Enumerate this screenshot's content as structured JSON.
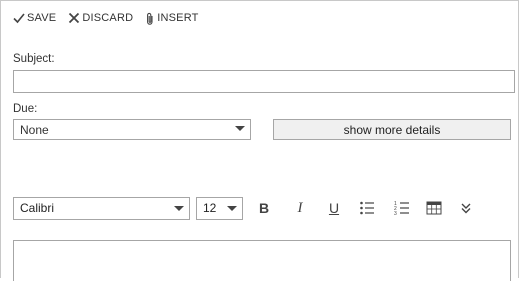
{
  "toolbar": {
    "save_label": "SAVE",
    "discard_label": "DISCARD",
    "insert_label": "INSERT"
  },
  "form": {
    "subject_label": "Subject:",
    "subject_value": "",
    "due_label": "Due:",
    "due_value": "None",
    "details_button_label": "show more details"
  },
  "format": {
    "font_value": "Calibri",
    "size_value": "12",
    "bold_glyph": "B",
    "italic_glyph": "I",
    "underline_glyph": "U"
  },
  "icons": [
    "check-icon",
    "x-icon",
    "paperclip-icon",
    "bullets-icon",
    "numbering-icon",
    "table-icon",
    "expand-more-icon"
  ],
  "colors": {
    "border": "#a6a6a6",
    "button_bg": "#f0f0f0",
    "text": "#333333"
  }
}
